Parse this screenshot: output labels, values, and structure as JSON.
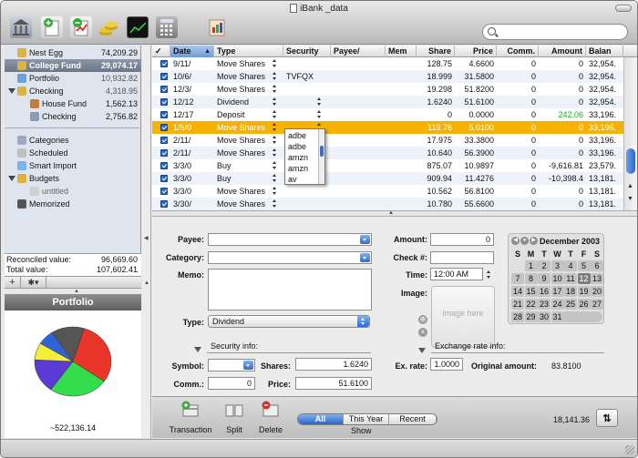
{
  "window": {
    "title": "iBank _data"
  },
  "toolbar": {
    "icons": [
      "bank-icon",
      "add-account-icon",
      "edit-account-icon",
      "coins-icon",
      "quote-monitor-icon",
      "calculator-icon",
      "report-icon"
    ],
    "search": {
      "value": "",
      "placeholder": ""
    }
  },
  "sidebar": {
    "accounts": [
      {
        "name": "Nest Egg",
        "balance": "74,209.29",
        "level": 0,
        "selected": false,
        "icon": "folder-icon",
        "dim": false
      },
      {
        "name": "College Fund",
        "balance": "29,074.17",
        "level": 0,
        "selected": true,
        "icon": "folder-icon",
        "dim": false
      },
      {
        "name": "Portfolio",
        "balance": "10,932.82",
        "level": 0,
        "selected": false,
        "icon": "portfolio-icon",
        "dim": true
      },
      {
        "name": "Checking",
        "balance": "4,318.95",
        "level": 0,
        "selected": false,
        "icon": "folder-icon",
        "dim": true
      },
      {
        "name": "House Fund",
        "balance": "1,562.13",
        "level": 1,
        "selected": false,
        "icon": "house-icon",
        "dim": false
      },
      {
        "name": "Checking",
        "balance": "2,756.82",
        "level": 1,
        "selected": false,
        "icon": "checkbook-icon",
        "dim": false
      }
    ],
    "tools": [
      {
        "name": "Categories",
        "icon": "categories-icon",
        "level": 0
      },
      {
        "name": "Scheduled",
        "icon": "scheduled-icon",
        "level": 0
      },
      {
        "name": "Smart Import",
        "icon": "smart-import-icon",
        "level": 0
      },
      {
        "name": "Budgets",
        "icon": "budgets-icon",
        "level": 0
      },
      {
        "name": "untitled",
        "icon": "budget-item-icon",
        "level": 1
      },
      {
        "name": "Memorized",
        "icon": "memorized-icon",
        "level": 0
      }
    ],
    "reconciled_label": "Reconciled value:",
    "reconciled_value": "96,669.60",
    "total_label": "Total value:",
    "total_value": "107,602.41",
    "add_label": "+",
    "action_label": "✱▾",
    "portfolio_title": "Portfolio",
    "portfolio_total": "~522,136.14"
  },
  "portfolio_chart": {
    "slices": [
      {
        "value": 30,
        "color": "#e8362b"
      },
      {
        "value": 25,
        "color": "#33dd4b"
      },
      {
        "value": 16,
        "color": "#5b3bd6"
      },
      {
        "value": 8,
        "color": "#f2ef3b"
      },
      {
        "value": 7,
        "color": "#2f63d8"
      },
      {
        "value": 14,
        "color": "#555555"
      }
    ]
  },
  "register": {
    "columns": [
      "✓",
      "Date",
      "Type",
      "Security",
      "Payee/",
      "Mem",
      "Share",
      "Price",
      "Comm.",
      "Amount",
      "Balan"
    ],
    "rows": [
      {
        "date": "9/11/",
        "type": "Move Shares",
        "security": "",
        "share": "128.75",
        "price": "4.6600",
        "comm": "0",
        "amount": "0",
        "balance": "32,954.",
        "amount_green": false
      },
      {
        "date": "10/6/",
        "type": "Move Shares",
        "security": "TVFQX",
        "share": "18.999",
        "price": "31.5800",
        "comm": "0",
        "amount": "0",
        "balance": "32,954.",
        "amount_green": false
      },
      {
        "date": "12/3/",
        "type": "Move Shares",
        "security": "",
        "share": "19.298",
        "price": "51.8200",
        "comm": "0",
        "amount": "0",
        "balance": "32,954.",
        "amount_green": false
      },
      {
        "date": "12/12",
        "type": "Dividend",
        "security": "",
        "share": "1.6240",
        "price": "51.6100",
        "comm": "0",
        "amount": "0",
        "balance": "32,954.",
        "amount_green": false
      },
      {
        "date": "12/17",
        "type": "Deposit",
        "security": "",
        "share": "0",
        "price": "0.0000",
        "comm": "0",
        "amount": "242.06",
        "balance": "33,196.",
        "amount_green": true
      },
      {
        "date": "1/5/0",
        "type": "Move Shares",
        "security": "",
        "share": "119.76",
        "price": "5.0100",
        "comm": "0",
        "amount": "0",
        "balance": "33,196.",
        "amount_green": false
      },
      {
        "date": "2/11/",
        "type": "Move Shares",
        "security": "",
        "share": "17.975",
        "price": "33.3800",
        "comm": "0",
        "amount": "0",
        "balance": "33,196.",
        "amount_green": false
      },
      {
        "date": "2/11/",
        "type": "Move Shares",
        "security": "",
        "share": "10.640",
        "price": "56.3900",
        "comm": "0",
        "amount": "0",
        "balance": "33,196.",
        "amount_green": false
      },
      {
        "date": "3/3/0",
        "type": "Buy",
        "security": "",
        "share": "875.07",
        "price": "10.9897",
        "comm": "0",
        "amount": "-9,616.81",
        "balance": "23,579.",
        "amount_green": false
      },
      {
        "date": "3/3/0",
        "type": "Buy",
        "security": "",
        "share": "909.94",
        "price": "11.4276",
        "comm": "0",
        "amount": "-10,398.4",
        "balance": "13,181.",
        "amount_green": false
      },
      {
        "date": "3/3/0",
        "type": "Move Shares",
        "security": "",
        "share": "10.562",
        "price": "56.8100",
        "comm": "0",
        "amount": "0",
        "balance": "13,181.",
        "amount_green": false
      },
      {
        "date": "3/30/",
        "type": "Move Shares",
        "security": "",
        "share": "10.780",
        "price": "55.6600",
        "comm": "0",
        "amount": "0",
        "balance": "13,181.",
        "amount_green": false
      }
    ],
    "selected_row": 5,
    "autocomplete": [
      "adbe",
      "adbe",
      "amzn",
      "amzn",
      "av"
    ]
  },
  "detail": {
    "payee_label": "Payee:",
    "payee_value": "",
    "category_label": "Category:",
    "category_value": "",
    "memo_label": "Memo:",
    "memo_value": "",
    "type_label": "Type:",
    "type_value": "Dividend",
    "amount_label": "Amount:",
    "amount_value": "0",
    "check_label": "Check #:",
    "check_value": "",
    "time_label": "Time:",
    "time_value": "12:00 AM",
    "image_label": "Image:",
    "image_placeholder": "image here",
    "security_info_label": "Security info:",
    "symbol_label": "Symbol:",
    "symbol_value": "",
    "shares_label": "Shares:",
    "shares_value": "1.6240",
    "comm_label": "Comm.:",
    "comm_value": "0",
    "price_label": "Price:",
    "price_value": "51.6100",
    "exchange_info_label": "Exchange rate info:",
    "exrate_label": "Ex. rate:",
    "exrate_value": "1.0000",
    "original_label": "Original amount:",
    "original_value": "83.8100"
  },
  "calendar": {
    "title": "December 2003",
    "dow": [
      "S",
      "M",
      "T",
      "W",
      "T",
      "F",
      "S"
    ],
    "first_col": 1,
    "days": 31,
    "selected": 12
  },
  "bottom": {
    "transaction_label": "Transaction",
    "split_label": "Split",
    "delete_label": "Delete",
    "segments": [
      "All",
      "This Year",
      "Recent"
    ],
    "active_segment": 0,
    "show_label": "Show",
    "balance": "18,141.36",
    "swap_label": "⇅"
  }
}
